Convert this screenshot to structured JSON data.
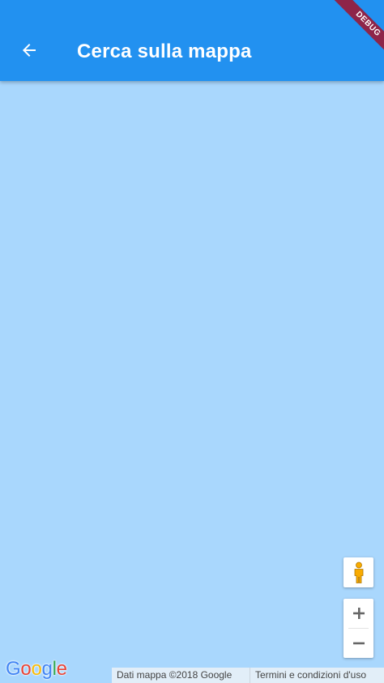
{
  "debug_banner": {
    "label": "DEBUG",
    "color": "#8e2549"
  },
  "appbar": {
    "title": "Cerca sulla mappa",
    "back_icon": "arrow-back-icon",
    "color": "#2291f0"
  },
  "map": {
    "background_color": "#a9d7fd",
    "controls": {
      "street_view_icon": "pegman-icon",
      "zoom_in_label": "+",
      "zoom_out_label": "−"
    },
    "logo": {
      "letters": [
        "G",
        "o",
        "o",
        "g",
        "l",
        "e"
      ],
      "colors": [
        "#4285f4",
        "#ea4335",
        "#fbbc05",
        "#4285f4",
        "#34a853",
        "#ea4335"
      ]
    },
    "attribution": {
      "data_text": "Dati mappa ©2018 Google",
      "terms_text": "Termini e condizioni d'uso"
    }
  }
}
